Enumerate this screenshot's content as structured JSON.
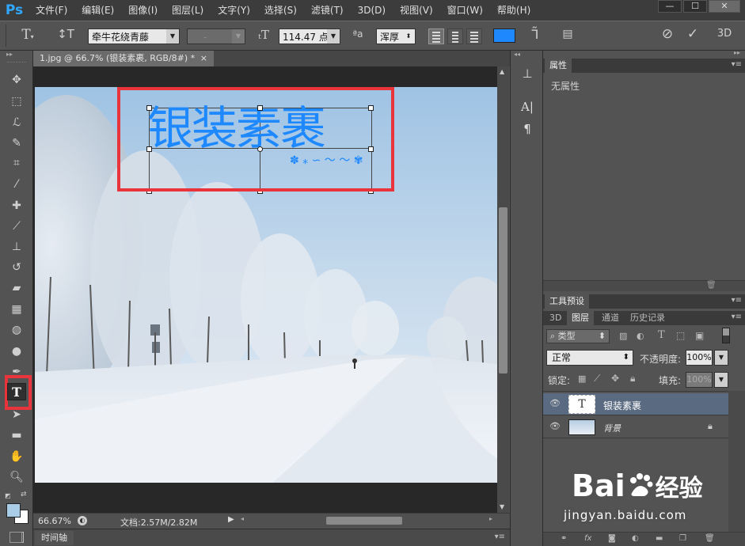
{
  "app": {
    "logo": "Ps",
    "menu": [
      "文件(F)",
      "编辑(E)",
      "图像(I)",
      "图层(L)",
      "文字(Y)",
      "选择(S)",
      "滤镜(T)",
      "3D(D)",
      "视图(V)",
      "窗口(W)",
      "帮助(H)"
    ],
    "window_controls": [
      "—",
      "☐",
      "✕"
    ]
  },
  "options": {
    "font_family": "牵牛花绕青藤",
    "font_style": "-",
    "font_size": "114.47 点",
    "aa_label": "ªa",
    "antialias": "浑厚",
    "color_hex": "#1e88ff"
  },
  "document": {
    "tab_title": "1.jpg @ 66.7% (银装素裹, RGB/8#) *",
    "tab_close": "×",
    "canvas_text": "银装素裹",
    "text_color": "#1e88ff",
    "zoom": "66.67%",
    "doc_size": "文档:2.57M/2.82M",
    "timeline": "时间轴"
  },
  "properties": {
    "title": "属性",
    "empty": "无属性"
  },
  "tool_presets": {
    "title": "工具预设"
  },
  "layers_panel": {
    "tabs": [
      "3D",
      "图层",
      "通道",
      "历史记录"
    ],
    "filter_kind": "类型",
    "blend_mode": "正常",
    "opacity_label": "不透明度:",
    "opacity_value": "100%",
    "lock_label": "锁定:",
    "fill_label": "填充:",
    "fill_value": "100%",
    "layers": [
      {
        "name": "银装素裹",
        "type": "text",
        "thumb": "T",
        "selected": true
      },
      {
        "name": "背景",
        "type": "image",
        "selected": false
      }
    ]
  },
  "watermark": {
    "brand_left": "Bai",
    "brand_right": "经验",
    "url": "jingyan.baidu.com"
  }
}
